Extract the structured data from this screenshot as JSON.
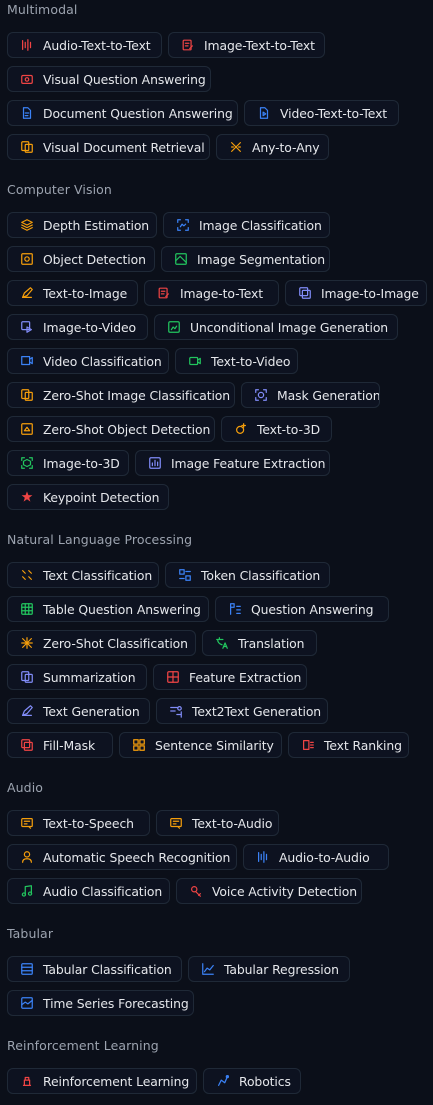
{
  "sections": [
    {
      "title": "Multimodal",
      "rows": [
        [
          {
            "label": "Audio-Text-to-Text",
            "icon": "audio-text-icon",
            "color": "#ef4444"
          },
          {
            "label": "Image-Text-to-Text",
            "icon": "image-text-icon",
            "color": "#ef4444"
          }
        ],
        [
          {
            "label": "Visual Question Answering",
            "icon": "visual-qa-icon",
            "color": "#ef4444"
          }
        ],
        [
          {
            "label": "Document Question Answering",
            "icon": "document-qa-icon",
            "color": "#3b82f6"
          },
          {
            "label": "Video-Text-to-Text",
            "icon": "video-text-icon",
            "color": "#3b82f6"
          }
        ],
        [
          {
            "label": "Visual Document Retrieval",
            "icon": "visual-doc-icon",
            "color": "#f59e0b"
          },
          {
            "label": "Any-to-Any",
            "icon": "any-to-any-icon",
            "color": "#f59e0b"
          }
        ]
      ]
    },
    {
      "title": "Computer Vision",
      "rows": [
        [
          {
            "label": "Depth Estimation",
            "icon": "depth-icon",
            "color": "#f59e0b"
          },
          {
            "label": "Image Classification",
            "icon": "image-class-icon",
            "color": "#3b82f6"
          }
        ],
        [
          {
            "label": "Object Detection",
            "icon": "object-detection-icon",
            "color": "#f59e0b"
          },
          {
            "label": "Image Segmentation",
            "icon": "segmentation-icon",
            "color": "#22c55e"
          }
        ],
        [
          {
            "label": "Text-to-Image",
            "icon": "text-to-image-icon",
            "color": "#f59e0b"
          },
          {
            "label": "Image-to-Text",
            "icon": "image-to-text-icon",
            "color": "#ef4444"
          },
          {
            "label": "Image-to-Image",
            "icon": "image-to-image-icon",
            "color": "#818cf8"
          }
        ],
        [
          {
            "label": "Image-to-Video",
            "icon": "image-to-video-icon",
            "color": "#818cf8"
          },
          {
            "label": "Unconditional Image Generation",
            "icon": "unconditional-gen-icon",
            "color": "#22c55e"
          }
        ],
        [
          {
            "label": "Video Classification",
            "icon": "video-class-icon",
            "color": "#3b82f6"
          },
          {
            "label": "Text-to-Video",
            "icon": "text-to-video-icon",
            "color": "#22c55e"
          }
        ],
        [
          {
            "label": "Zero-Shot Image Classification",
            "icon": "zero-shot-image-icon",
            "color": "#f59e0b"
          },
          {
            "label": "Mask Generation",
            "icon": "mask-icon",
            "color": "#818cf8"
          }
        ],
        [
          {
            "label": "Zero-Shot Object Detection",
            "icon": "zero-shot-object-icon",
            "color": "#f59e0b"
          },
          {
            "label": "Text-to-3D",
            "icon": "text-to-3d-icon",
            "color": "#f59e0b"
          }
        ],
        [
          {
            "label": "Image-to-3D",
            "icon": "image-to-3d-icon",
            "color": "#22c55e"
          },
          {
            "label": "Image Feature Extraction",
            "icon": "image-feature-icon",
            "color": "#818cf8"
          }
        ],
        [
          {
            "label": "Keypoint Detection",
            "icon": "keypoint-icon",
            "color": "#ef4444"
          }
        ]
      ]
    },
    {
      "title": "Natural Language Processing",
      "rows": [
        [
          {
            "label": "Text Classification",
            "icon": "text-class-icon",
            "color": "#f59e0b"
          },
          {
            "label": "Token Classification",
            "icon": "token-class-icon",
            "color": "#3b82f6"
          }
        ],
        [
          {
            "label": "Table Question Answering",
            "icon": "table-qa-icon",
            "color": "#22c55e"
          },
          {
            "label": "Question Answering",
            "icon": "qa-icon",
            "color": "#3b82f6"
          }
        ],
        [
          {
            "label": "Zero-Shot Classification",
            "icon": "zero-shot-class-icon",
            "color": "#f59e0b"
          },
          {
            "label": "Translation",
            "icon": "translation-icon",
            "color": "#22c55e"
          }
        ],
        [
          {
            "label": "Summarization",
            "icon": "summarization-icon",
            "color": "#818cf8"
          },
          {
            "label": "Feature Extraction",
            "icon": "feature-extraction-icon",
            "color": "#ef4444"
          }
        ],
        [
          {
            "label": "Text Generation",
            "icon": "text-gen-icon",
            "color": "#818cf8"
          },
          {
            "label": "Text2Text Generation",
            "icon": "text2text-icon",
            "color": "#818cf8"
          }
        ],
        [
          {
            "label": "Fill-Mask",
            "icon": "fill-mask-icon",
            "color": "#ef4444"
          },
          {
            "label": "Sentence Similarity",
            "icon": "sentence-sim-icon",
            "color": "#f59e0b"
          },
          {
            "label": "Text Ranking",
            "icon": "text-ranking-icon",
            "color": "#ef4444"
          }
        ]
      ]
    },
    {
      "title": "Audio",
      "rows": [
        [
          {
            "label": "Text-to-Speech",
            "icon": "text-to-speech-icon",
            "color": "#f59e0b"
          },
          {
            "label": "Text-to-Audio",
            "icon": "text-to-audio-icon",
            "color": "#f59e0b"
          }
        ],
        [
          {
            "label": "Automatic Speech Recognition",
            "icon": "asr-icon",
            "color": "#f59e0b"
          },
          {
            "label": "Audio-to-Audio",
            "icon": "audio-to-audio-icon",
            "color": "#3b82f6"
          }
        ],
        [
          {
            "label": "Audio Classification",
            "icon": "audio-class-icon",
            "color": "#22c55e"
          },
          {
            "label": "Voice Activity Detection",
            "icon": "vad-icon",
            "color": "#ef4444"
          }
        ]
      ]
    },
    {
      "title": "Tabular",
      "rows": [
        [
          {
            "label": "Tabular Classification",
            "icon": "tabular-class-icon",
            "color": "#3b82f6"
          },
          {
            "label": "Tabular Regression",
            "icon": "tabular-regression-icon",
            "color": "#3b82f6"
          }
        ],
        [
          {
            "label": "Time Series Forecasting",
            "icon": "time-series-icon",
            "color": "#3b82f6"
          }
        ]
      ]
    },
    {
      "title": "Reinforcement Learning",
      "rows": [
        [
          {
            "label": "Reinforcement Learning",
            "icon": "rl-icon",
            "color": "#ef4444"
          },
          {
            "label": "Robotics",
            "icon": "robotics-icon",
            "color": "#3b82f6"
          }
        ]
      ]
    }
  ]
}
